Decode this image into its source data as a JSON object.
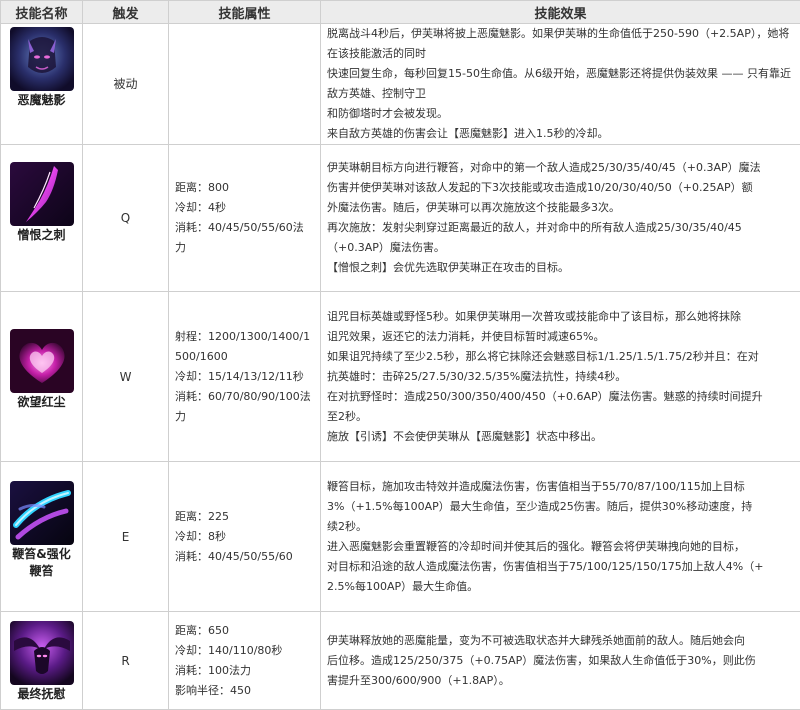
{
  "headers": [
    "技能名称",
    "触发",
    "技能属性",
    "技能效果"
  ],
  "skills": [
    {
      "name": "恶魔魅影",
      "icon": "passive-demon-shade-icon",
      "trigger": "被动",
      "attributes": [],
      "effect": [
        "脱离战斗4秒后，伊芙琳将披上恶魔魅影。如果伊芙琳的生命值低于250-590（+2.5AP），她将在该技能激活的同时",
        "快速回复生命，每秒回复15-50生命值。从6级开始，恶魔魅影还将提供伪装效果 —— 只有靠近敌方英雄、控制守卫",
        "和防御塔时才会被发现。",
        "来自敌方英雄的伤害会让【恶魔魅影】进入1.5秒的冷却。"
      ]
    },
    {
      "name": "憎恨之刺",
      "icon": "hate-spike-icon",
      "trigger": "Q",
      "attributes": [
        "距离：800",
        "冷却：4秒",
        "消耗：40/45/50/55/60法",
        "力"
      ],
      "effect": [
        "伊芙琳朝目标方向进行鞭笞，对命中的第一个敌人造成25/30/35/40/45（+0.3AP）魔法",
        "伤害并使伊芙琳对该敌人发起的下3次技能或攻击造成10/20/30/40/50（+0.25AP）额",
        "外魔法伤害。随后，伊芙琳可以再次施放这个技能最多3次。",
        "再次施放：发射尖刺穿过距离最近的敌人，并对命中的所有敌人造成25/30/35/40/45",
        "（+0.3AP）魔法伤害。",
        "【憎恨之刺】会优先选取伊芙琳正在攻击的目标。"
      ]
    },
    {
      "name": "欲望红尘",
      "icon": "allure-heart-icon",
      "trigger": "W",
      "attributes": [
        "射程：1200/1300/1400/1",
        "500/1600",
        "冷却：15/14/13/12/11秒",
        "消耗：60/70/80/90/100法",
        "力"
      ],
      "effect": [
        "诅咒目标英雄或野怪5秒。如果伊芙琳用一次普攻或技能命中了该目标，那么她将抹除",
        "诅咒效果，返还它的法力消耗，并使目标暂时减速65%。",
        "如果诅咒持续了至少2.5秒，那么将它抹除还会魅惑目标1/1.25/1.5/1.75/2秒并且：在对",
        "抗英雄时：击碎25/27.5/30/32.5/35%魔法抗性，持续4秒。",
        "在对抗野怪时：造成250/300/350/400/450（+0.6AP）魔法伤害。魅惑的持续时间提升",
        "至2秒。",
        "施放【引诱】不会使伊芙琳从【恶魔魅影】状态中移出。"
      ]
    },
    {
      "name": "鞭笞&强化鞭笞",
      "name_lines": [
        "鞭笞&强化",
        "鞭笞"
      ],
      "icon": "whiplash-icon",
      "trigger": "E",
      "attributes": [
        "距离：225",
        "冷却：8秒",
        "消耗：40/45/50/55/60"
      ],
      "effect": [
        "鞭笞目标，施加攻击特效并造成魔法伤害，伤害值相当于55/70/87/100/115加上目标",
        "3%（+1.5%每100AP）最大生命值，至少造成25伤害。随后，提供30%移动速度，持",
        "续2秒。",
        "进入恶魔魅影会重置鞭笞的冷却时间并使其后的强化。鞭笞会将伊芙琳拽向她的目标，",
        "对目标和沿途的敌人造成魔法伤害，伤害值相当于75/100/125/150/175加上敌人4%（+",
        "2.5%每100AP）最大生命值。"
      ]
    },
    {
      "name": "最终抚慰",
      "icon": "last-caress-icon",
      "trigger": "R",
      "attributes": [
        "距离：650",
        "冷却：140/110/80秒",
        "消耗：100法力",
        "影响半径：450"
      ],
      "effect": [
        "伊芙琳释放她的恶魔能量，变为不可被选取状态并大肆残杀她面前的敌人。随后她会向",
        "后位移。造成125/250/375（+0.75AP）魔法伤害，如果敌人生命值低于30%，则此伤",
        "害提升至300/600/900（+1.8AP）。"
      ]
    }
  ]
}
